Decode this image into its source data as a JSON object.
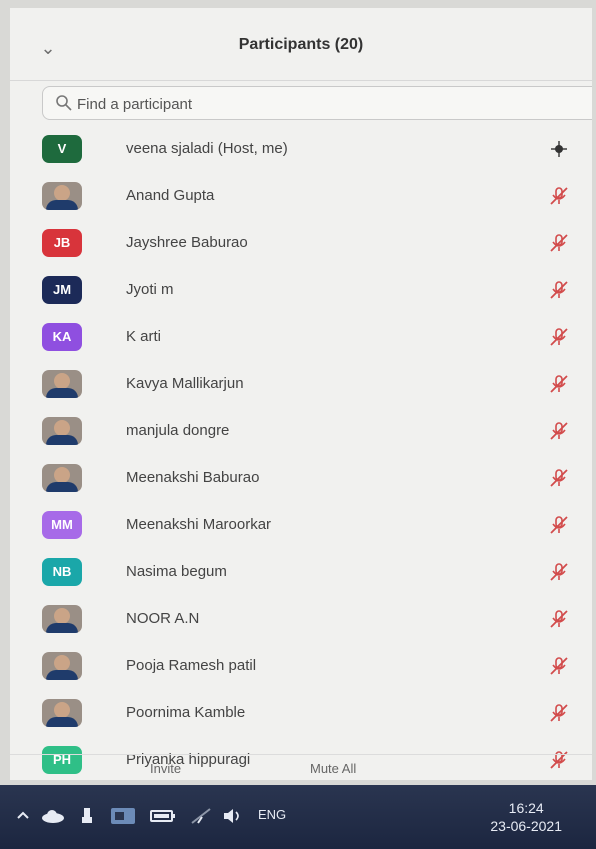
{
  "panel": {
    "title": "Participants (20)",
    "collapse_icon": "chevron-down-icon",
    "search": {
      "placeholder": "Find a participant",
      "value": ""
    },
    "participants": [
      {
        "name": "veena sjaladi (Host, me)",
        "avatar": {
          "type": "initials",
          "text": "V",
          "color": "#1e6a3d"
        },
        "status_icon": "audio-active-icon"
      },
      {
        "name": "Anand Gupta",
        "avatar": {
          "type": "photo"
        },
        "status_icon": "mic-muted-icon"
      },
      {
        "name": "Jayshree Baburao",
        "avatar": {
          "type": "initials",
          "text": "JB",
          "color": "#d8343b"
        },
        "status_icon": "mic-muted-icon"
      },
      {
        "name": "Jyoti m",
        "avatar": {
          "type": "initials",
          "text": "JM",
          "color": "#1c2a58"
        },
        "status_icon": "mic-muted-icon"
      },
      {
        "name": "K arti",
        "avatar": {
          "type": "initials",
          "text": "KA",
          "color": "#8f4fe0"
        },
        "status_icon": "mic-muted-icon"
      },
      {
        "name": "Kavya Mallikarjun",
        "avatar": {
          "type": "photo"
        },
        "status_icon": "mic-muted-icon"
      },
      {
        "name": "manjula dongre",
        "avatar": {
          "type": "photo"
        },
        "status_icon": "mic-muted-icon"
      },
      {
        "name": "Meenakshi Baburao",
        "avatar": {
          "type": "photo"
        },
        "status_icon": "mic-muted-icon"
      },
      {
        "name": "Meenakshi Maroorkar",
        "avatar": {
          "type": "initials",
          "text": "MM",
          "color": "#a76ae8"
        },
        "status_icon": "mic-muted-icon"
      },
      {
        "name": "Nasima begum",
        "avatar": {
          "type": "initials",
          "text": "NB",
          "color": "#1aa7a9"
        },
        "status_icon": "mic-muted-icon"
      },
      {
        "name": "NOOR A.N",
        "avatar": {
          "type": "photo"
        },
        "status_icon": "mic-muted-icon"
      },
      {
        "name": "Pooja Ramesh patil",
        "avatar": {
          "type": "photo"
        },
        "status_icon": "mic-muted-icon"
      },
      {
        "name": "Poornima Kamble",
        "avatar": {
          "type": "photo"
        },
        "status_icon": "mic-muted-icon"
      },
      {
        "name": "Priyanka hippuragi",
        "avatar": {
          "type": "initials",
          "text": "PH",
          "color": "#2fbf87"
        },
        "status_icon": "mic-muted-icon"
      }
    ],
    "footer": {
      "invite_label": "Invite",
      "mute_all_label": "Mute All"
    }
  },
  "taskbar": {
    "language": "ENG",
    "time": "16:24",
    "date": "23-06-2021",
    "icons": [
      "chevron-up-icon",
      "cloud-icon",
      "usb-icon",
      "meet-icon",
      "battery-icon",
      "network-icon",
      "volume-icon"
    ]
  },
  "colors": {
    "muted_mic": "#d24b4b",
    "taskbar": "#23304a"
  }
}
